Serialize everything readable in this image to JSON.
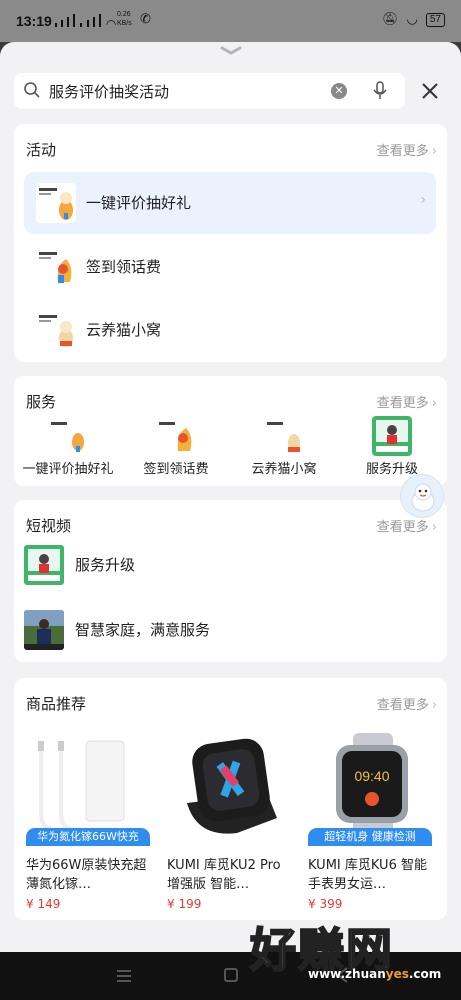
{
  "status_bar": {
    "time": "13:19",
    "network_speed": "0.26\nKB/s",
    "battery": "57"
  },
  "search": {
    "query": "服务评价抽奖活动",
    "close_label": "×"
  },
  "activities": {
    "title": "活动",
    "more": "查看更多",
    "items": [
      {
        "label": "一键评价抽好礼",
        "thumb_text": "评价抽好礼"
      },
      {
        "label": "签到领话费",
        "thumb_text": "签到领话费"
      },
      {
        "label": "云养猫小窝",
        "thumb_text": "云养猫小窝"
      }
    ]
  },
  "services": {
    "title": "服务",
    "more": "查看更多",
    "items": [
      {
        "label": "一键评价抽好礼"
      },
      {
        "label": "签到领话费"
      },
      {
        "label": "云养猫小窝"
      },
      {
        "label": "服务升级"
      }
    ]
  },
  "videos": {
    "title": "短视频",
    "more": "查看更多",
    "items": [
      {
        "label": "服务升级"
      },
      {
        "label": "智慧家庭，满意服务"
      }
    ]
  },
  "products": {
    "title": "商品推荐",
    "more": "查看更多",
    "items": [
      {
        "tag": "华为氮化镓66W快充",
        "name": "华为66W原装快充超薄氮化镓…",
        "price": "¥ 149"
      },
      {
        "tag": "",
        "name": "KUMI 库觅KU2 Pro增强版 智能…",
        "price": "¥ 199"
      },
      {
        "tag": "超轻机身 健康检测",
        "name": "KUMI 库觅KU6 智能手表男女运…",
        "price": "¥ 399"
      }
    ]
  },
  "watermark": {
    "big": "好赚网",
    "url_a": "www.zhuan",
    "url_b": "yes",
    "url_c": ".com"
  },
  "colors": {
    "accent": "#2f8df0",
    "price": "#e53935",
    "highlight_row": "#eaf2fd"
  }
}
